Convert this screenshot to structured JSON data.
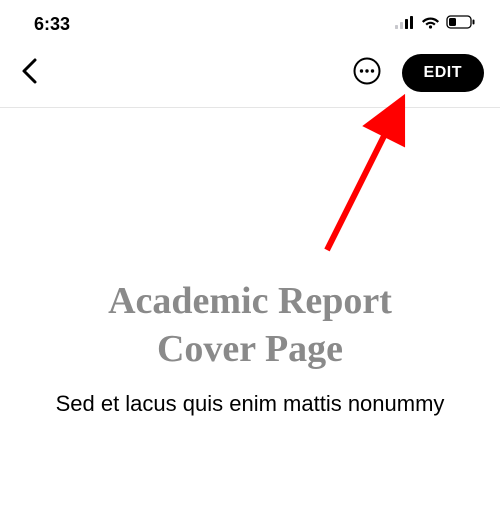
{
  "status": {
    "time": "6:33"
  },
  "nav": {
    "edit_label": "EDIT"
  },
  "document": {
    "title_line1": "Academic Report",
    "title_line2": "Cover Page",
    "subtitle": "Sed et lacus quis enim mattis nonummy"
  },
  "annotation": {
    "arrow_color": "#ff0000"
  }
}
